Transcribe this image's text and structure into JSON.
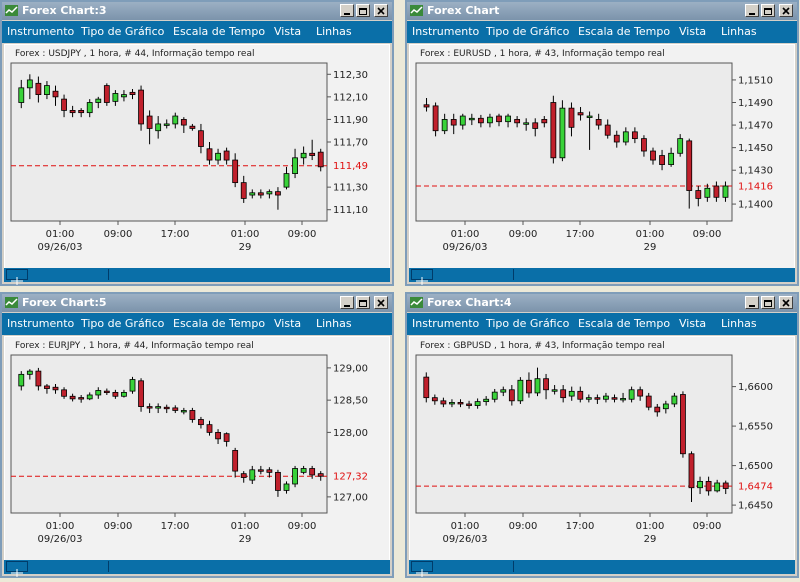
{
  "colors": {
    "menu_bg": "#0a6fa8",
    "up_candle": "#39d239",
    "down_candle": "#c0202c",
    "grid": "#555555",
    "last_price_line": "#e01010",
    "chart_bg": "#f2f2f2"
  },
  "menu": [
    "Instrumento",
    "Tipo de Gráfico",
    "Escala de Tempo",
    "Vista",
    "Linhas"
  ],
  "time_axis": {
    "ticks": [
      "01:00",
      "09:00",
      "17:00",
      "01:00",
      "09:00"
    ],
    "date_left": "09/26/03",
    "date_right": "29"
  },
  "windows": [
    {
      "title": "Forex Chart:3",
      "info": "Forex : USDJPY , 1 hora, # 44, Informação tempo real",
      "price_ticks": [
        "112,30",
        "112,10",
        "111,90",
        "111,70",
        "111,30",
        "111,10"
      ],
      "last_price": "111,49",
      "chart_data": {
        "type": "candlestick",
        "symbol": "USDJPY",
        "ylim": [
          111.0,
          112.4
        ],
        "last": 111.49,
        "candles": [
          [
            112.05,
            112.18,
            112.25,
            112.0
          ],
          [
            112.18,
            112.25,
            112.3,
            112.08
          ],
          [
            112.22,
            112.12,
            112.28,
            112.05
          ],
          [
            112.12,
            112.2,
            112.24,
            112.08
          ],
          [
            112.15,
            112.1,
            112.2,
            112.02
          ],
          [
            112.08,
            111.98,
            112.12,
            111.92
          ],
          [
            111.98,
            111.96,
            112.02,
            111.92
          ],
          [
            111.98,
            111.96,
            112.0,
            111.92
          ],
          [
            111.96,
            112.05,
            112.08,
            111.92
          ],
          [
            112.05,
            112.08,
            112.1,
            112.0
          ],
          [
            112.2,
            112.05,
            112.22,
            112.02
          ],
          [
            112.06,
            112.13,
            112.16,
            112.02
          ],
          [
            112.1,
            112.12,
            112.16,
            112.06
          ],
          [
            112.14,
            112.12,
            112.17,
            112.08
          ],
          [
            112.16,
            111.86,
            112.2,
            111.8
          ],
          [
            111.93,
            111.82,
            111.98,
            111.68
          ],
          [
            111.8,
            111.86,
            111.93,
            111.73
          ],
          [
            111.86,
            111.86,
            111.9,
            111.82
          ],
          [
            111.86,
            111.93,
            111.96,
            111.82
          ],
          [
            111.9,
            111.85,
            111.92,
            111.78
          ],
          [
            111.84,
            111.82,
            111.86,
            111.8
          ],
          [
            111.8,
            111.66,
            111.86,
            111.6
          ],
          [
            111.64,
            111.54,
            111.7,
            111.5
          ],
          [
            111.54,
            111.6,
            111.64,
            111.5
          ],
          [
            111.62,
            111.54,
            111.65,
            111.5
          ],
          [
            111.54,
            111.34,
            111.6,
            111.3
          ],
          [
            111.34,
            111.2,
            111.4,
            111.16
          ],
          [
            111.23,
            111.25,
            111.28,
            111.2
          ],
          [
            111.25,
            111.23,
            111.28,
            111.2
          ],
          [
            111.24,
            111.26,
            111.28,
            111.2
          ],
          [
            111.26,
            111.23,
            111.3,
            111.1
          ],
          [
            111.3,
            111.42,
            111.48,
            111.28
          ],
          [
            111.42,
            111.56,
            111.64,
            111.38
          ],
          [
            111.56,
            111.6,
            111.66,
            111.5
          ],
          [
            111.6,
            111.58,
            111.72,
            111.54
          ],
          [
            111.61,
            111.48,
            111.64,
            111.44
          ]
        ]
      }
    },
    {
      "title": "Forex Chart",
      "info": "Forex : EURUSD , 1 hora, # 43, Informação tempo real",
      "price_ticks": [
        "1,1510",
        "1,1490",
        "1,1470",
        "1,1450",
        "1,1430",
        "1,1400"
      ],
      "last_price": "1,1416",
      "chart_data": {
        "type": "candlestick",
        "symbol": "EURUSD",
        "ylim": [
          1.1385,
          1.1525
        ],
        "last": 1.1416,
        "candles": [
          [
            1.1488,
            1.1486,
            1.1494,
            1.1482
          ],
          [
            1.1487,
            1.1465,
            1.149,
            1.146
          ],
          [
            1.1465,
            1.1475,
            1.148,
            1.1462
          ],
          [
            1.1475,
            1.147,
            1.148,
            1.1462
          ],
          [
            1.147,
            1.1478,
            1.148,
            1.1466
          ],
          [
            1.1476,
            1.1476,
            1.148,
            1.147
          ],
          [
            1.1476,
            1.1472,
            1.1479,
            1.1468
          ],
          [
            1.1472,
            1.1477,
            1.148,
            1.1468
          ],
          [
            1.1478,
            1.1473,
            1.148,
            1.1469
          ],
          [
            1.1473,
            1.1478,
            1.148,
            1.1468
          ],
          [
            1.1475,
            1.1472,
            1.1478,
            1.1468
          ],
          [
            1.1472,
            1.1472,
            1.1476,
            1.1465
          ],
          [
            1.1472,
            1.1467,
            1.1476,
            1.146
          ],
          [
            1.1475,
            1.1472,
            1.1478,
            1.1468
          ],
          [
            1.149,
            1.1441,
            1.1496,
            1.1436
          ],
          [
            1.1441,
            1.1485,
            1.1492,
            1.1438
          ],
          [
            1.1485,
            1.1468,
            1.149,
            1.146
          ],
          [
            1.1481,
            1.1479,
            1.1486,
            1.1474
          ],
          [
            1.1478,
            1.1478,
            1.1482,
            1.1448
          ],
          [
            1.1475,
            1.147,
            1.148,
            1.1466
          ],
          [
            1.147,
            1.1461,
            1.1475,
            1.1458
          ],
          [
            1.1461,
            1.1455,
            1.1465,
            1.145
          ],
          [
            1.1455,
            1.1464,
            1.1468,
            1.1452
          ],
          [
            1.1464,
            1.1458,
            1.1468,
            1.1454
          ],
          [
            1.1458,
            1.1447,
            1.1461,
            1.1442
          ],
          [
            1.1447,
            1.1439,
            1.145,
            1.1435
          ],
          [
            1.1443,
            1.1435,
            1.1448,
            1.143
          ],
          [
            1.1435,
            1.1445,
            1.145,
            1.1433
          ],
          [
            1.1445,
            1.1458,
            1.1462,
            1.1442
          ],
          [
            1.1456,
            1.1412,
            1.1458,
            1.1396
          ],
          [
            1.1412,
            1.1405,
            1.1416,
            1.1398
          ],
          [
            1.1406,
            1.1414,
            1.1418,
            1.1402
          ],
          [
            1.1416,
            1.1406,
            1.142,
            1.1402
          ],
          [
            1.1406,
            1.1416,
            1.142,
            1.1402
          ]
        ]
      }
    },
    {
      "title": "Forex Chart:5",
      "info": "Forex : EURJPY , 1 hora, # 44, Informação tempo real",
      "price_ticks": [
        "129,00",
        "128,50",
        "128,00",
        "127,00"
      ],
      "last_price": "127,32",
      "chart_data": {
        "type": "candlestick",
        "symbol": "EURJPY",
        "ylim": [
          126.75,
          129.2
        ],
        "last": 127.32,
        "candles": [
          [
            128.72,
            128.9,
            128.95,
            128.65
          ],
          [
            128.9,
            128.95,
            128.98,
            128.82
          ],
          [
            128.95,
            128.72,
            129.0,
            128.65
          ],
          [
            128.72,
            128.68,
            128.75,
            128.6
          ],
          [
            128.7,
            128.66,
            128.75,
            128.6
          ],
          [
            128.66,
            128.56,
            128.7,
            128.52
          ],
          [
            128.56,
            128.52,
            128.6,
            128.48
          ],
          [
            128.54,
            128.52,
            128.58,
            128.46
          ],
          [
            128.52,
            128.58,
            128.62,
            128.5
          ],
          [
            128.58,
            128.65,
            128.7,
            128.52
          ],
          [
            128.64,
            128.62,
            128.68,
            128.58
          ],
          [
            128.62,
            128.56,
            128.66,
            128.52
          ],
          [
            128.56,
            128.62,
            128.66,
            128.54
          ],
          [
            128.64,
            128.82,
            128.86,
            128.6
          ],
          [
            128.8,
            128.4,
            128.84,
            128.32
          ],
          [
            128.4,
            128.38,
            128.45,
            128.3
          ],
          [
            128.38,
            128.4,
            128.45,
            128.3
          ],
          [
            128.39,
            128.38,
            128.43,
            128.3
          ],
          [
            128.38,
            128.34,
            128.42,
            128.3
          ],
          [
            128.34,
            128.34,
            128.38,
            128.28
          ],
          [
            128.34,
            128.2,
            128.38,
            128.15
          ],
          [
            128.2,
            128.12,
            128.24,
            128.06
          ],
          [
            128.12,
            128.0,
            128.18,
            127.95
          ],
          [
            128.0,
            127.9,
            128.05,
            127.82
          ],
          [
            127.98,
            127.86,
            128.0,
            127.78
          ],
          [
            127.72,
            127.4,
            127.76,
            127.3
          ],
          [
            127.36,
            127.3,
            127.4,
            127.22
          ],
          [
            127.26,
            127.42,
            127.48,
            127.2
          ],
          [
            127.42,
            127.4,
            127.48,
            127.35
          ],
          [
            127.42,
            127.38,
            127.46,
            127.3
          ],
          [
            127.38,
            127.1,
            127.42,
            127.0
          ],
          [
            127.1,
            127.2,
            127.24,
            127.05
          ],
          [
            127.2,
            127.44,
            127.48,
            127.15
          ],
          [
            127.38,
            127.44,
            127.48,
            127.35
          ],
          [
            127.44,
            127.34,
            127.48,
            127.28
          ],
          [
            127.36,
            127.32,
            127.4,
            127.25
          ]
        ]
      }
    },
    {
      "title": "Forex Chart:4",
      "info": "Forex : GBPUSD , 1 hora, # 43, Informação tempo real",
      "price_ticks": [
        "1,6600",
        "1,6550",
        "1,6500",
        "1,6450"
      ],
      "last_price": "1,6474",
      "chart_data": {
        "type": "candlestick",
        "symbol": "GBPUSD",
        "ylim": [
          1.644,
          1.664
        ],
        "last": 1.6474,
        "candles": [
          [
            1.6612,
            1.6586,
            1.6618,
            1.658
          ],
          [
            1.6586,
            1.6582,
            1.659,
            1.6577
          ],
          [
            1.6582,
            1.6578,
            1.6586,
            1.6574
          ],
          [
            1.6578,
            1.658,
            1.6584,
            1.6574
          ],
          [
            1.658,
            1.6578,
            1.6584,
            1.6574
          ],
          [
            1.6578,
            1.6576,
            1.6582,
            1.6572
          ],
          [
            1.6576,
            1.6581,
            1.6585,
            1.6572
          ],
          [
            1.6581,
            1.6584,
            1.6588,
            1.6576
          ],
          [
            1.6584,
            1.6593,
            1.6597,
            1.658
          ],
          [
            1.6593,
            1.6596,
            1.66,
            1.6588
          ],
          [
            1.6596,
            1.6582,
            1.6602,
            1.6576
          ],
          [
            1.6582,
            1.6608,
            1.6612,
            1.6578
          ],
          [
            1.6608,
            1.6592,
            1.6618,
            1.6586
          ],
          [
            1.6592,
            1.661,
            1.6624,
            1.6588
          ],
          [
            1.661,
            1.6596,
            1.6616,
            1.6584
          ],
          [
            1.6596,
            1.6596,
            1.6602,
            1.659
          ],
          [
            1.6596,
            1.6586,
            1.6602,
            1.658
          ],
          [
            1.6588,
            1.6594,
            1.66,
            1.6582
          ],
          [
            1.6594,
            1.6584,
            1.66,
            1.658
          ],
          [
            1.6584,
            1.6586,
            1.659,
            1.658
          ],
          [
            1.6586,
            1.6584,
            1.659,
            1.6578
          ],
          [
            1.6584,
            1.6588,
            1.6592,
            1.658
          ],
          [
            1.6586,
            1.6584,
            1.659,
            1.658
          ],
          [
            1.6584,
            1.6585,
            1.6592,
            1.658
          ],
          [
            1.6584,
            1.6596,
            1.66,
            1.658
          ],
          [
            1.6596,
            1.6588,
            1.66,
            1.6582
          ],
          [
            1.6588,
            1.6574,
            1.6592,
            1.657
          ],
          [
            1.6574,
            1.6568,
            1.6578,
            1.6562
          ],
          [
            1.6572,
            1.6578,
            1.6582,
            1.6566
          ],
          [
            1.6578,
            1.6588,
            1.6592,
            1.6574
          ],
          [
            1.659,
            1.6515,
            1.6594,
            1.651
          ],
          [
            1.6515,
            1.6472,
            1.6518,
            1.6454
          ],
          [
            1.6472,
            1.648,
            1.6486,
            1.6464
          ],
          [
            1.648,
            1.6468,
            1.6486,
            1.6462
          ],
          [
            1.6468,
            1.6478,
            1.6482,
            1.6466
          ],
          [
            1.6478,
            1.6471,
            1.6481,
            1.6464
          ]
        ]
      }
    }
  ]
}
